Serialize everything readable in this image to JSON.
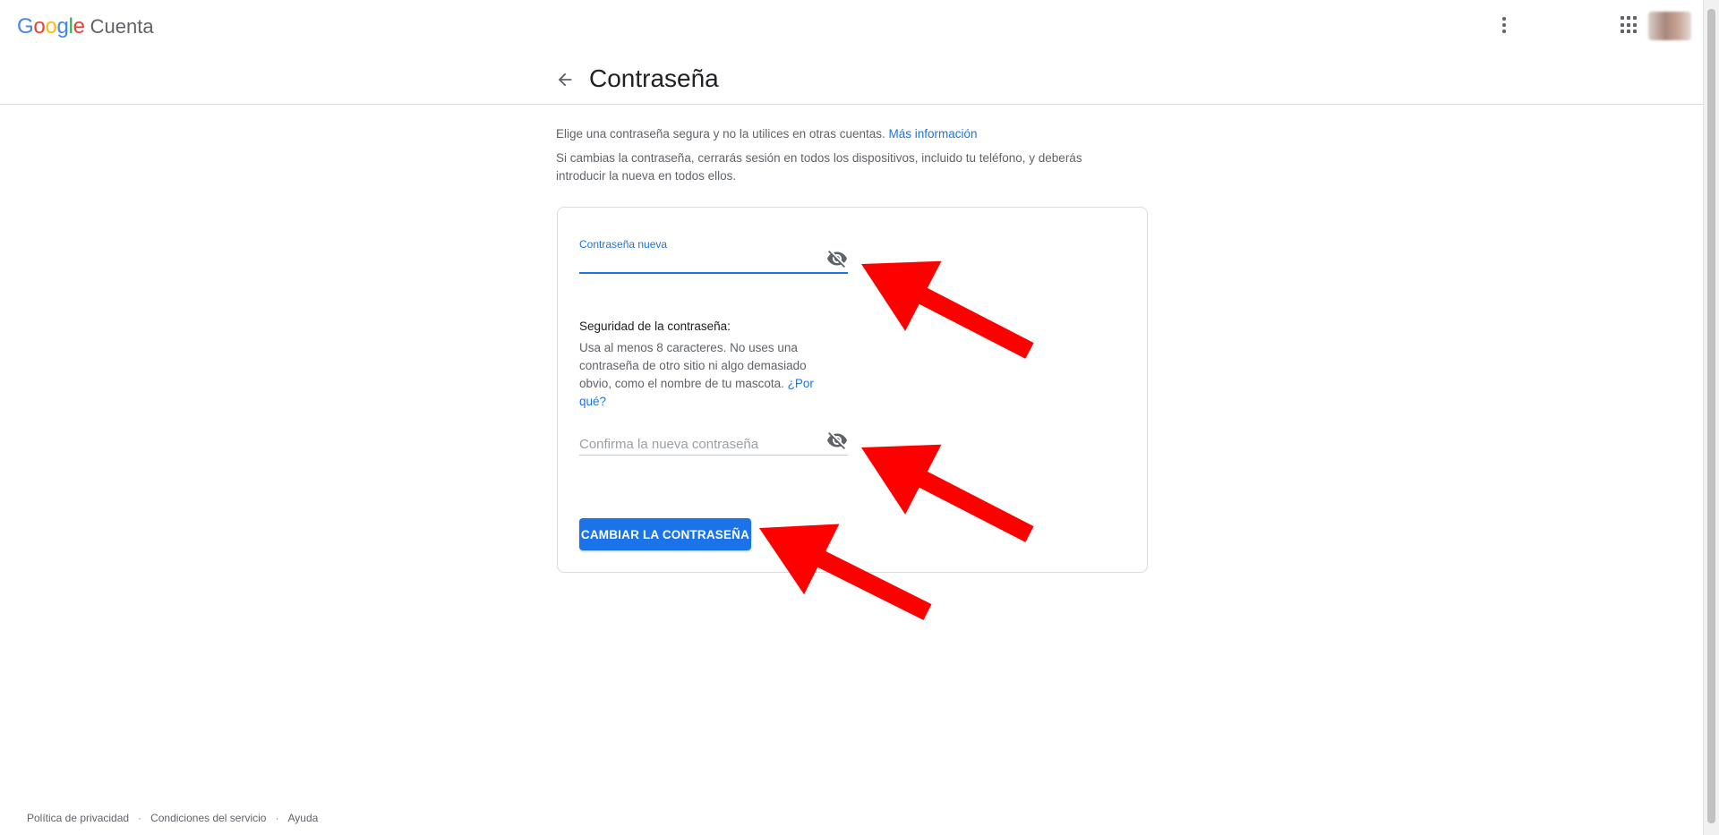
{
  "header": {
    "logo_letters": [
      {
        "char": "G",
        "color": "#4285F4"
      },
      {
        "char": "o",
        "color": "#EA4335"
      },
      {
        "char": "o",
        "color": "#FBBC05"
      },
      {
        "char": "g",
        "color": "#4285F4"
      },
      {
        "char": "l",
        "color": "#34A853"
      },
      {
        "char": "e",
        "color": "#EA4335"
      }
    ],
    "product": "Cuenta",
    "menu_icon": "more-vert-icon",
    "apps_icon": "apps-grid-icon"
  },
  "page": {
    "title": "Contraseña",
    "back_icon": "arrow-back-icon",
    "intro_line1": "Elige una contraseña segura y no la utilices en otras cuentas.",
    "intro_link": "Más información",
    "intro_line2": "Si cambias la contraseña, cerrarás sesión en todos los dispositivos, incluido tu teléfono, y deberás introducir la nueva en todos ellos."
  },
  "form": {
    "new_password_label": "Contraseña nueva",
    "new_password_value": "",
    "strength_title": "Seguridad de la contraseña:",
    "strength_text": "Usa al menos 8 caracteres. No uses una contraseña de otro sitio ni algo demasiado obvio, como el nombre de tu mascota.",
    "strength_link": "¿Por qué?",
    "confirm_placeholder": "Confirma la nueva contraseña",
    "visibility_icon": "visibility-off-icon",
    "submit_label": "CAMBIAR LA CONTRASEÑA"
  },
  "footer": {
    "links": [
      "Política de privacidad",
      "Condiciones del servicio",
      "Ayuda"
    ],
    "separator": "·"
  },
  "colors": {
    "accent": "#1a73e8",
    "annotation_arrow": "#ff0000"
  }
}
